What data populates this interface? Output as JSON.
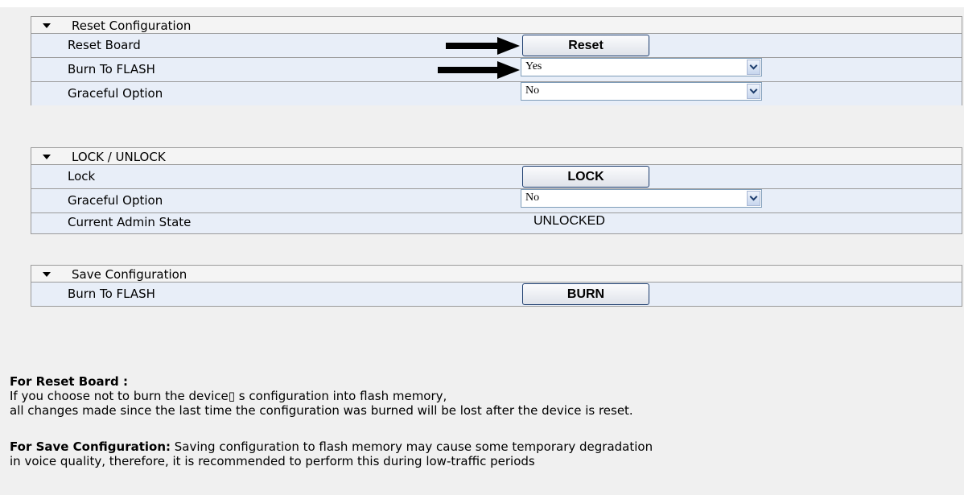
{
  "sections": [
    {
      "title": "Reset Configuration",
      "rows": [
        {
          "label": "Reset Board",
          "button": "Reset"
        },
        {
          "label": "Burn To FLASH",
          "select_value": "Yes"
        },
        {
          "label": "Graceful Option",
          "select_value": "No"
        }
      ]
    },
    {
      "title": "LOCK / UNLOCK",
      "rows": [
        {
          "label": "Lock",
          "button": "LOCK"
        },
        {
          "label": "Graceful Option",
          "select_value": "No"
        },
        {
          "label": "Current Admin State",
          "value": "UNLOCKED"
        }
      ]
    },
    {
      "title": "Save Configuration",
      "rows": [
        {
          "label": "Burn To FLASH",
          "button": "BURN"
        }
      ]
    }
  ],
  "help": {
    "reset_heading": "For Reset Board :",
    "reset_line1": "If you choose not to burn the device▯ s configuration into flash memory,",
    "reset_line2": "all changes made since the last time the configuration was burned will be lost after the device is reset.",
    "save_heading": "For Save Configuration:",
    "save_line1": " Saving configuration to flash memory may cause some temporary degradation",
    "save_line2": "in voice quality, therefore, it is recommended to perform this during low-traffic periods"
  },
  "icons": [
    "triangle-down-icon",
    "arrow-right-icon",
    "chevron-down-icon"
  ],
  "colors": {
    "panel": "#e8eef8",
    "header": "#f4f4f4",
    "button_border": "#1c3c6c"
  }
}
